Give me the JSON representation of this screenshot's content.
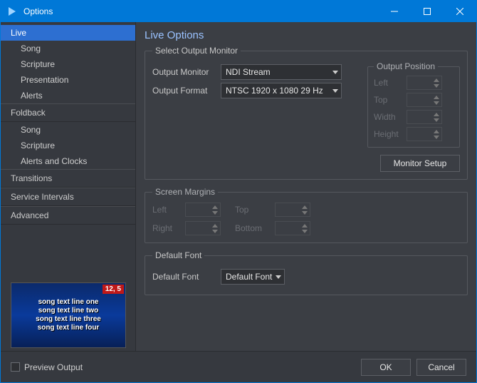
{
  "window": {
    "title": "Options"
  },
  "sidebar": {
    "groups": [
      {
        "label": "Live",
        "items": [
          "Song",
          "Scripture",
          "Presentation",
          "Alerts"
        ],
        "selected": true
      },
      {
        "label": "Foldback",
        "items": [
          "Song",
          "Scripture",
          "Alerts and Clocks"
        ]
      }
    ],
    "singles": [
      "Transitions",
      "Service Intervals",
      "Advanced"
    ]
  },
  "preview": {
    "badge": "12, 5",
    "lines": [
      "song text line one",
      "song text line two",
      "song text line three",
      "song text line four"
    ]
  },
  "content": {
    "title": "Live Options",
    "output": {
      "legend": "Select Output Monitor",
      "monitor_label": "Output Monitor",
      "monitor_value": "NDI Stream",
      "format_label": "Output Format",
      "format_value": "NTSC 1920 x 1080 29 Hz",
      "position_legend": "Output Position",
      "pos_labels": {
        "left": "Left",
        "top": "Top",
        "width": "Width",
        "height": "Height"
      },
      "setup_btn": "Monitor Setup"
    },
    "margins": {
      "legend": "Screen Margins",
      "left": "Left",
      "right": "Right",
      "top": "Top",
      "bottom": "Bottom"
    },
    "font": {
      "legend": "Default Font",
      "label": "Default Font",
      "value": "Default Font"
    }
  },
  "footer": {
    "preview_label": "Preview Output",
    "ok": "OK",
    "cancel": "Cancel"
  }
}
